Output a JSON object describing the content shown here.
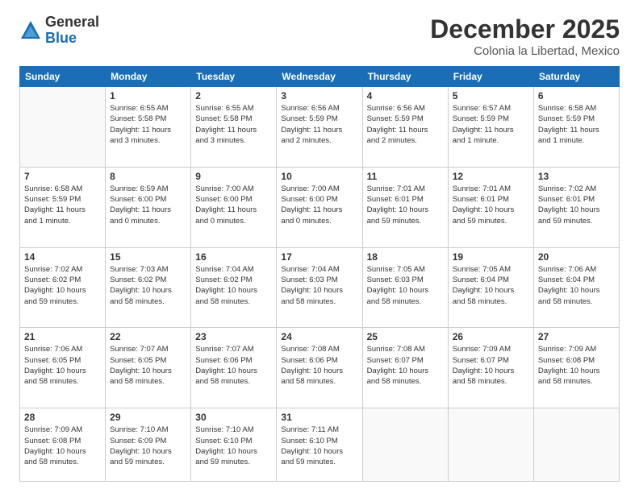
{
  "logo": {
    "general": "General",
    "blue": "Blue"
  },
  "header": {
    "month": "December 2025",
    "location": "Colonia la Libertad, Mexico"
  },
  "days_of_week": [
    "Sunday",
    "Monday",
    "Tuesday",
    "Wednesday",
    "Thursday",
    "Friday",
    "Saturday"
  ],
  "weeks": [
    [
      {
        "day": "",
        "info": ""
      },
      {
        "day": "1",
        "info": "Sunrise: 6:55 AM\nSunset: 5:58 PM\nDaylight: 11 hours\nand 3 minutes."
      },
      {
        "day": "2",
        "info": "Sunrise: 6:55 AM\nSunset: 5:58 PM\nDaylight: 11 hours\nand 3 minutes."
      },
      {
        "day": "3",
        "info": "Sunrise: 6:56 AM\nSunset: 5:59 PM\nDaylight: 11 hours\nand 2 minutes."
      },
      {
        "day": "4",
        "info": "Sunrise: 6:56 AM\nSunset: 5:59 PM\nDaylight: 11 hours\nand 2 minutes."
      },
      {
        "day": "5",
        "info": "Sunrise: 6:57 AM\nSunset: 5:59 PM\nDaylight: 11 hours\nand 1 minute."
      },
      {
        "day": "6",
        "info": "Sunrise: 6:58 AM\nSunset: 5:59 PM\nDaylight: 11 hours\nand 1 minute."
      }
    ],
    [
      {
        "day": "7",
        "info": "Sunrise: 6:58 AM\nSunset: 5:59 PM\nDaylight: 11 hours\nand 1 minute."
      },
      {
        "day": "8",
        "info": "Sunrise: 6:59 AM\nSunset: 6:00 PM\nDaylight: 11 hours\nand 0 minutes."
      },
      {
        "day": "9",
        "info": "Sunrise: 7:00 AM\nSunset: 6:00 PM\nDaylight: 11 hours\nand 0 minutes."
      },
      {
        "day": "10",
        "info": "Sunrise: 7:00 AM\nSunset: 6:00 PM\nDaylight: 11 hours\nand 0 minutes."
      },
      {
        "day": "11",
        "info": "Sunrise: 7:01 AM\nSunset: 6:01 PM\nDaylight: 10 hours\nand 59 minutes."
      },
      {
        "day": "12",
        "info": "Sunrise: 7:01 AM\nSunset: 6:01 PM\nDaylight: 10 hours\nand 59 minutes."
      },
      {
        "day": "13",
        "info": "Sunrise: 7:02 AM\nSunset: 6:01 PM\nDaylight: 10 hours\nand 59 minutes."
      }
    ],
    [
      {
        "day": "14",
        "info": "Sunrise: 7:02 AM\nSunset: 6:02 PM\nDaylight: 10 hours\nand 59 minutes."
      },
      {
        "day": "15",
        "info": "Sunrise: 7:03 AM\nSunset: 6:02 PM\nDaylight: 10 hours\nand 58 minutes."
      },
      {
        "day": "16",
        "info": "Sunrise: 7:04 AM\nSunset: 6:02 PM\nDaylight: 10 hours\nand 58 minutes."
      },
      {
        "day": "17",
        "info": "Sunrise: 7:04 AM\nSunset: 6:03 PM\nDaylight: 10 hours\nand 58 minutes."
      },
      {
        "day": "18",
        "info": "Sunrise: 7:05 AM\nSunset: 6:03 PM\nDaylight: 10 hours\nand 58 minutes."
      },
      {
        "day": "19",
        "info": "Sunrise: 7:05 AM\nSunset: 6:04 PM\nDaylight: 10 hours\nand 58 minutes."
      },
      {
        "day": "20",
        "info": "Sunrise: 7:06 AM\nSunset: 6:04 PM\nDaylight: 10 hours\nand 58 minutes."
      }
    ],
    [
      {
        "day": "21",
        "info": "Sunrise: 7:06 AM\nSunset: 6:05 PM\nDaylight: 10 hours\nand 58 minutes."
      },
      {
        "day": "22",
        "info": "Sunrise: 7:07 AM\nSunset: 6:05 PM\nDaylight: 10 hours\nand 58 minutes."
      },
      {
        "day": "23",
        "info": "Sunrise: 7:07 AM\nSunset: 6:06 PM\nDaylight: 10 hours\nand 58 minutes."
      },
      {
        "day": "24",
        "info": "Sunrise: 7:08 AM\nSunset: 6:06 PM\nDaylight: 10 hours\nand 58 minutes."
      },
      {
        "day": "25",
        "info": "Sunrise: 7:08 AM\nSunset: 6:07 PM\nDaylight: 10 hours\nand 58 minutes."
      },
      {
        "day": "26",
        "info": "Sunrise: 7:09 AM\nSunset: 6:07 PM\nDaylight: 10 hours\nand 58 minutes."
      },
      {
        "day": "27",
        "info": "Sunrise: 7:09 AM\nSunset: 6:08 PM\nDaylight: 10 hours\nand 58 minutes."
      }
    ],
    [
      {
        "day": "28",
        "info": "Sunrise: 7:09 AM\nSunset: 6:08 PM\nDaylight: 10 hours\nand 58 minutes."
      },
      {
        "day": "29",
        "info": "Sunrise: 7:10 AM\nSunset: 6:09 PM\nDaylight: 10 hours\nand 59 minutes."
      },
      {
        "day": "30",
        "info": "Sunrise: 7:10 AM\nSunset: 6:10 PM\nDaylight: 10 hours\nand 59 minutes."
      },
      {
        "day": "31",
        "info": "Sunrise: 7:11 AM\nSunset: 6:10 PM\nDaylight: 10 hours\nand 59 minutes."
      },
      {
        "day": "",
        "info": ""
      },
      {
        "day": "",
        "info": ""
      },
      {
        "day": "",
        "info": ""
      }
    ]
  ]
}
